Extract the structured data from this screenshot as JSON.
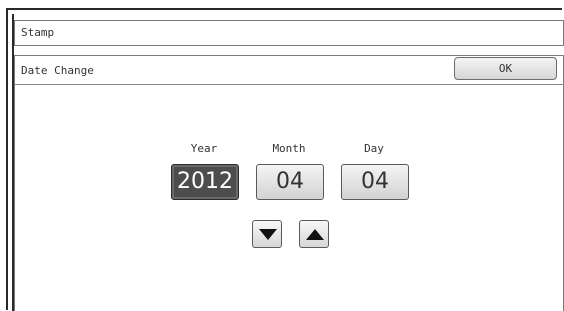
{
  "window": {
    "title": "Stamp"
  },
  "dialog": {
    "heading": "Date Change",
    "ok_label": "OK"
  },
  "date": {
    "year_label": "Year",
    "month_label": "Month",
    "day_label": "Day",
    "year_value": "2012",
    "month_value": "04",
    "day_value": "04",
    "selected_field": "year"
  },
  "controls": {
    "down_icon": "triangle-down-icon",
    "up_icon": "triangle-up-icon"
  },
  "colors": {
    "selected_field_bg": "#4d4d4d",
    "border": "#2a2a2a"
  }
}
